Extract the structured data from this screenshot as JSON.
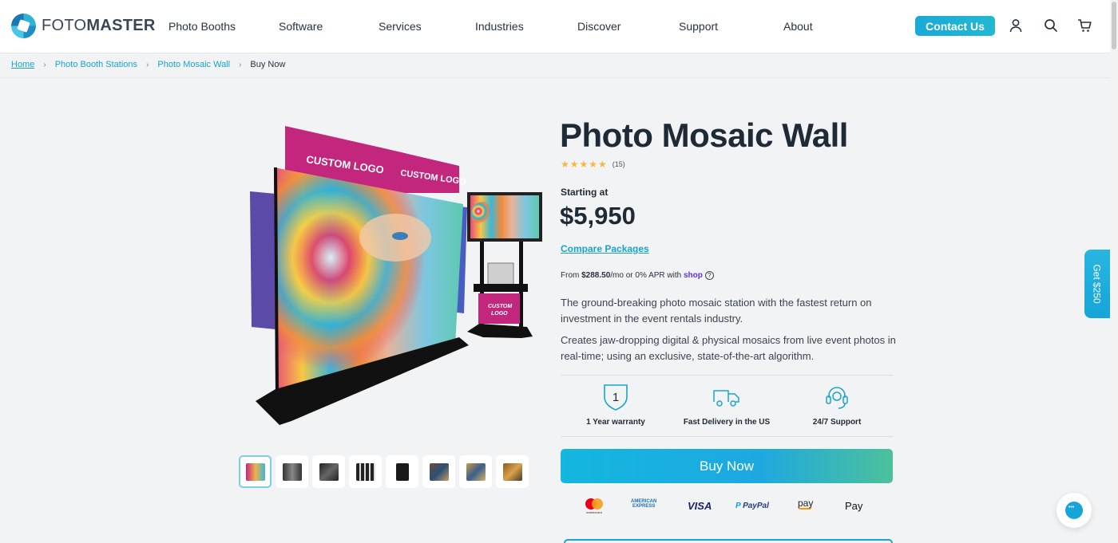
{
  "brand": {
    "name_light": "FOTO",
    "name_bold": "MASTER"
  },
  "nav": {
    "items": [
      "Photo Booths",
      "Software",
      "Services",
      "Industries",
      "Discover",
      "Support",
      "About"
    ],
    "contact_label": "Contact Us"
  },
  "icons": {
    "account": "user-icon",
    "search": "search-icon",
    "cart": "cart-icon"
  },
  "breadcrumb": {
    "home": "Home",
    "level1": "Photo Booth Stations",
    "level2": "Photo Mosaic Wall",
    "current": "Buy Now"
  },
  "product": {
    "title": "Photo Mosaic Wall",
    "stars": "★★★★★",
    "review_count": "(15)",
    "starting_label": "Starting at",
    "price": "$5,950",
    "compare_label": "Compare Packages",
    "installment_prefix": "From ",
    "installment_amount": "$288.50",
    "installment_mid": "/mo or 0% APR with ",
    "installment_provider": "shop",
    "description_1": "The ground-breaking photo mosaic station with the fastest return on investment in the event rentals industry.",
    "description_2": "Creates jaw-dropping digital & physical mosaics from live event photos in real-time; using an exclusive, state-of-the-art algorithm.",
    "image_banner_1": "CUSTOM LOGO",
    "image_banner_2": "CUSTOM LOGO",
    "image_stand_logo_1": "CUSTOM",
    "image_stand_logo_2": "LOGO",
    "thumbnail_count": 8
  },
  "features": [
    {
      "label": "1 Year warranty",
      "icon": "shield-one-icon",
      "icon_text": "1"
    },
    {
      "label": "Fast Delivery in the US",
      "icon": "truck-icon"
    },
    {
      "label": "24/7 Support",
      "icon": "headset-icon"
    }
  ],
  "buy_label": "Buy Now",
  "payments": {
    "mastercard_caption": "mastercard",
    "amex_line1": "AMERICAN",
    "amex_line2": "EXPRESS",
    "visa": "VISA",
    "paypal": "PayPal",
    "amazon": "pay",
    "apple": "Pay"
  },
  "side_tab_label": "Get $250",
  "colors": {
    "accent": "#1aa3cf",
    "shop": "#5a31f4",
    "star": "#f4b740",
    "magenta": "#c2267d"
  }
}
